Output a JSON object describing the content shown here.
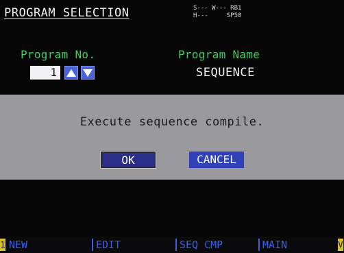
{
  "header": {
    "title": "PROGRAM SELECTION",
    "status_line1": "S--- W--- RB1",
    "status_line2": "H---     SP50"
  },
  "program": {
    "no_label": "Program No.",
    "no_value": "1",
    "name_label": "Program Name",
    "name_value": "SEQUENCE"
  },
  "dialog": {
    "message": "Execute sequence compile.",
    "ok_label": "OK",
    "cancel_label": "CANCEL"
  },
  "function_keys": {
    "left_marker": "1",
    "right_marker": "V",
    "f1": "NEW",
    "f2": "EDIT",
    "f3": "SEQ CMP",
    "f4": "MAIN"
  },
  "colors": {
    "label_green": "#39d25e",
    "dialog_gray": "#9a9a9e",
    "button_blue": "#3040b8",
    "fkey_blue": "#3b5fe0",
    "fkey_marker": "#d8c020"
  }
}
